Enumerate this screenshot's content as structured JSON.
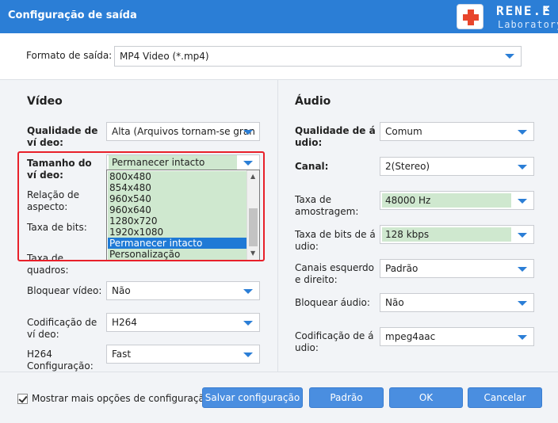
{
  "window": {
    "title": "Configuração de saída",
    "brand_line1": "RENE.E",
    "brand_line2": "Laboratory",
    "close_symbol": "×"
  },
  "format": {
    "label": "Formato de saída:",
    "value": "MP4 Video (*.mp4)"
  },
  "video": {
    "heading": "Vídeo",
    "quality_label": "Qualidade de ví deo:",
    "quality_value": "Alta (Arquivos tornam-se grand",
    "size_label": "Tamanho do ví deo:",
    "size_value": "Permanecer intacto",
    "size_options": [
      "800x480",
      "854x480",
      "960x540",
      "960x640",
      "1280x720",
      "1920x1080",
      "Permanecer intacto",
      "Personalização"
    ],
    "size_selected_index": 6,
    "aspect_label": "Relação de aspecto:",
    "bitrate_label": "Taxa de bits:",
    "framerate_label": "Taxa de quadros:",
    "lock_label": "Bloquear vídeo:",
    "lock_value": "Não",
    "codec_label": "Codificação de ví deo:",
    "codec_value": "H264",
    "h264_label": "H264 Configuração:",
    "h264_value": "Fast"
  },
  "audio": {
    "heading": "Áudio",
    "quality_label": "Qualidade de á udio:",
    "quality_value": "Comum",
    "channel_label": "Canal:",
    "channel_value": "2(Stereo)",
    "samplerate_label": "Taxa de amostragem:",
    "samplerate_value": "48000 Hz",
    "bitrate_label": "Taxa de bits de á udio:",
    "bitrate_value": "128 kbps",
    "lr_label": "Canais esquerdo e direito:",
    "lr_value": "Padrão",
    "lock_label": "Bloquear áudio:",
    "lock_value": "Não",
    "codec_label": "Codificação de á udio:",
    "codec_value": "mpeg4aac"
  },
  "footer": {
    "more_options_label": "Mostrar mais opções de configuração",
    "more_options_checked": true,
    "save_button": "Salvar configuração",
    "default_button": "Padrão",
    "ok_button": "OK",
    "cancel_button": "Cancelar"
  },
  "colors": {
    "titlebar": "#2b7ed6",
    "button": "#4a8ee0",
    "highlight_green": "#cfe8cf",
    "selection_blue": "#1f7ad6",
    "annotation_red": "#e8202a"
  }
}
